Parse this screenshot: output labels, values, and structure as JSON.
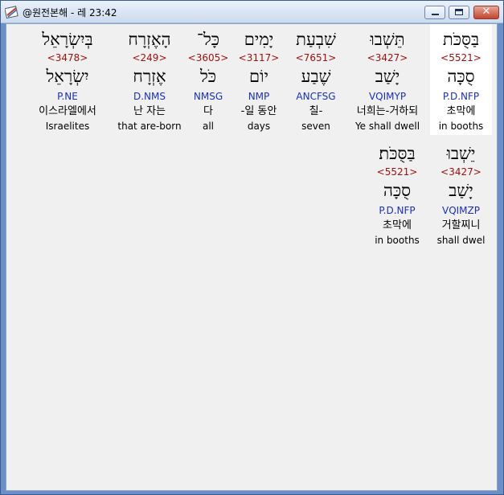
{
  "window": {
    "title": "@원전본해 - 레 23:42",
    "icon": "book-icon"
  },
  "lines": [
    {
      "words": [
        {
          "surface": "בַּסֻּכֹּת",
          "strong": "<5521>",
          "lemma": "סֻכָּה",
          "morph": "P.D.NFP",
          "korean": "초막에",
          "english": "in booths",
          "selected": true
        },
        {
          "surface": "תֵּשְׁבוּ",
          "strong": "<3427>",
          "lemma": "יָשַׁב",
          "morph": "VQIMYP",
          "korean": "너희는-거하되",
          "english": "Ye shall dwell",
          "selected": false
        },
        {
          "surface": "שִׁבְעַת",
          "strong": "<7651>",
          "lemma": "שֶׁבַע",
          "morph": "ANCFSG",
          "korean": "칠-",
          "english": "seven",
          "selected": false
        },
        {
          "surface": "יָמִים",
          "strong": "<3117>",
          "lemma": "יוֹם",
          "morph": "NMP",
          "korean": "-일 동안",
          "english": "days",
          "selected": false
        },
        {
          "surface": "כָּל־",
          "strong": "<3605>",
          "lemma": "כֹּל",
          "morph": "NMSG",
          "korean": "다",
          "english": "all",
          "selected": false
        },
        {
          "surface": "הָאֶזְרָח",
          "strong": "<249>",
          "lemma": "אֶזְרָח",
          "morph": "D.NMS",
          "korean": "난 자는",
          "english": "that are-born",
          "selected": false
        },
        {
          "surface": "בְּיִשְׂרָאֵל",
          "strong": "<3478>",
          "lemma": "יִשְׂרָאֵל",
          "morph": "P.NE",
          "korean": "이스라엘에서",
          "english": "Israelites",
          "selected": false
        }
      ]
    },
    {
      "words": [
        {
          "surface": "יֵשְׁבוּ",
          "strong": "<3427>",
          "lemma": "יָשַׁב",
          "morph": "VQIMZP",
          "korean": "거할찌니",
          "english": "shall dwel",
          "selected": false
        },
        {
          "surface": "בַּסֻּכֹּת׃",
          "strong": "<5521>",
          "lemma": "סֻכָּה",
          "morph": "P.D.NFP",
          "korean": "초막에",
          "english": "in booths",
          "selected": false
        }
      ]
    }
  ]
}
